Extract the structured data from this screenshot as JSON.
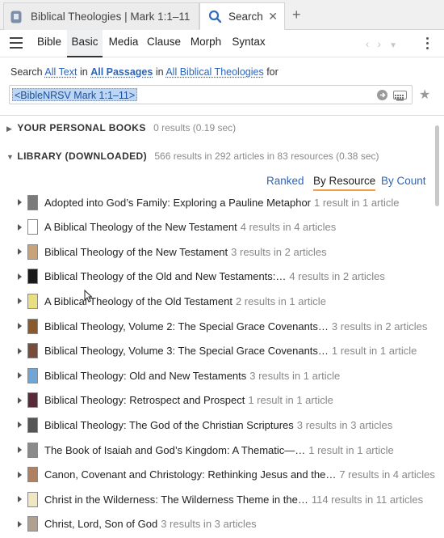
{
  "tabs": [
    {
      "label": "Biblical Theologies | Mark 1:1–11",
      "icon": "book-icon"
    },
    {
      "label": "Search",
      "icon": "search-icon",
      "close": "✕"
    }
  ],
  "new_tab_glyph": "+",
  "toolbar": {
    "modes": [
      "Bible",
      "Basic",
      "Media",
      "Clause",
      "Morph",
      "Syntax"
    ],
    "active_mode": "Basic"
  },
  "search_line": {
    "prefix": "Search",
    "scope_text": "All Text",
    "in1": "in",
    "passages": "All Passages",
    "in2": "in",
    "collection": "All Biblical Theologies",
    "for": "for"
  },
  "query": "<BibleNRSV Mark 1:1–11>",
  "sections": {
    "personal": {
      "title": "YOUR PERSONAL BOOKS",
      "meta": "0 results (0.19 sec)",
      "expanded": false
    },
    "library": {
      "title": "LIBRARY (DOWNLOADED)",
      "meta": "566 results in 292 articles in 83 resources (0.38 sec)",
      "expanded": true
    }
  },
  "sort": {
    "ranked": "Ranked",
    "by_resource": "By Resource",
    "by_count": "By Count",
    "active": "By Resource"
  },
  "results": [
    {
      "title": "Adopted into God’s Family: Exploring a Pauline Metaphor",
      "count": "1 result in 1 article",
      "cover": "#7a7a7a"
    },
    {
      "title": "A Biblical Theology of the New Testament",
      "count": "4 results in 4 articles",
      "cover": "#ffffff"
    },
    {
      "title": "Biblical Theology of the New Testament",
      "count": "3 results in 2 articles",
      "cover": "#c9a27a"
    },
    {
      "title": "Biblical Theology of the Old and New Testaments:…",
      "count": "4 results in 2 articles",
      "cover": "#1a1a1a"
    },
    {
      "title": "A Biblical Theology of the Old Testament",
      "count": "2 results in 1 article",
      "cover": "#e8e080"
    },
    {
      "title": "Biblical Theology, Volume 2: The Special Grace Covenants…",
      "count": "3 results in 2 articles",
      "cover": "#8a5a2a"
    },
    {
      "title": "Biblical Theology, Volume 3: The Special Grace Covenants…",
      "count": "1 result in 1 article",
      "cover": "#7a4a3a"
    },
    {
      "title": "Biblical Theology: Old and New Testaments",
      "count": "3 results in 1 article",
      "cover": "#6fa6d6"
    },
    {
      "title": "Biblical Theology: Retrospect and Prospect",
      "count": "1 result in 1 article",
      "cover": "#5a2a3a"
    },
    {
      "title": "Biblical Theology: The God of the Christian Scriptures",
      "count": "3 results in 3 articles",
      "cover": "#555555"
    },
    {
      "title": "The Book of Isaiah and God’s Kingdom: A Thematic—…",
      "count": "1 result in 1 article",
      "cover": "#8a8a8a"
    },
    {
      "title": "Canon, Covenant and Christology: Rethinking Jesus and the…",
      "count": "7 results in 4 articles",
      "cover": "#b08060"
    },
    {
      "title": "Christ in the Wilderness: The Wilderness Theme in the…",
      "count": "114 results in 11 articles",
      "cover": "#f0e6c0"
    },
    {
      "title": "Christ, Lord, Son of God",
      "count": "3 results in 3 articles",
      "cover": "#b0a090"
    }
  ]
}
